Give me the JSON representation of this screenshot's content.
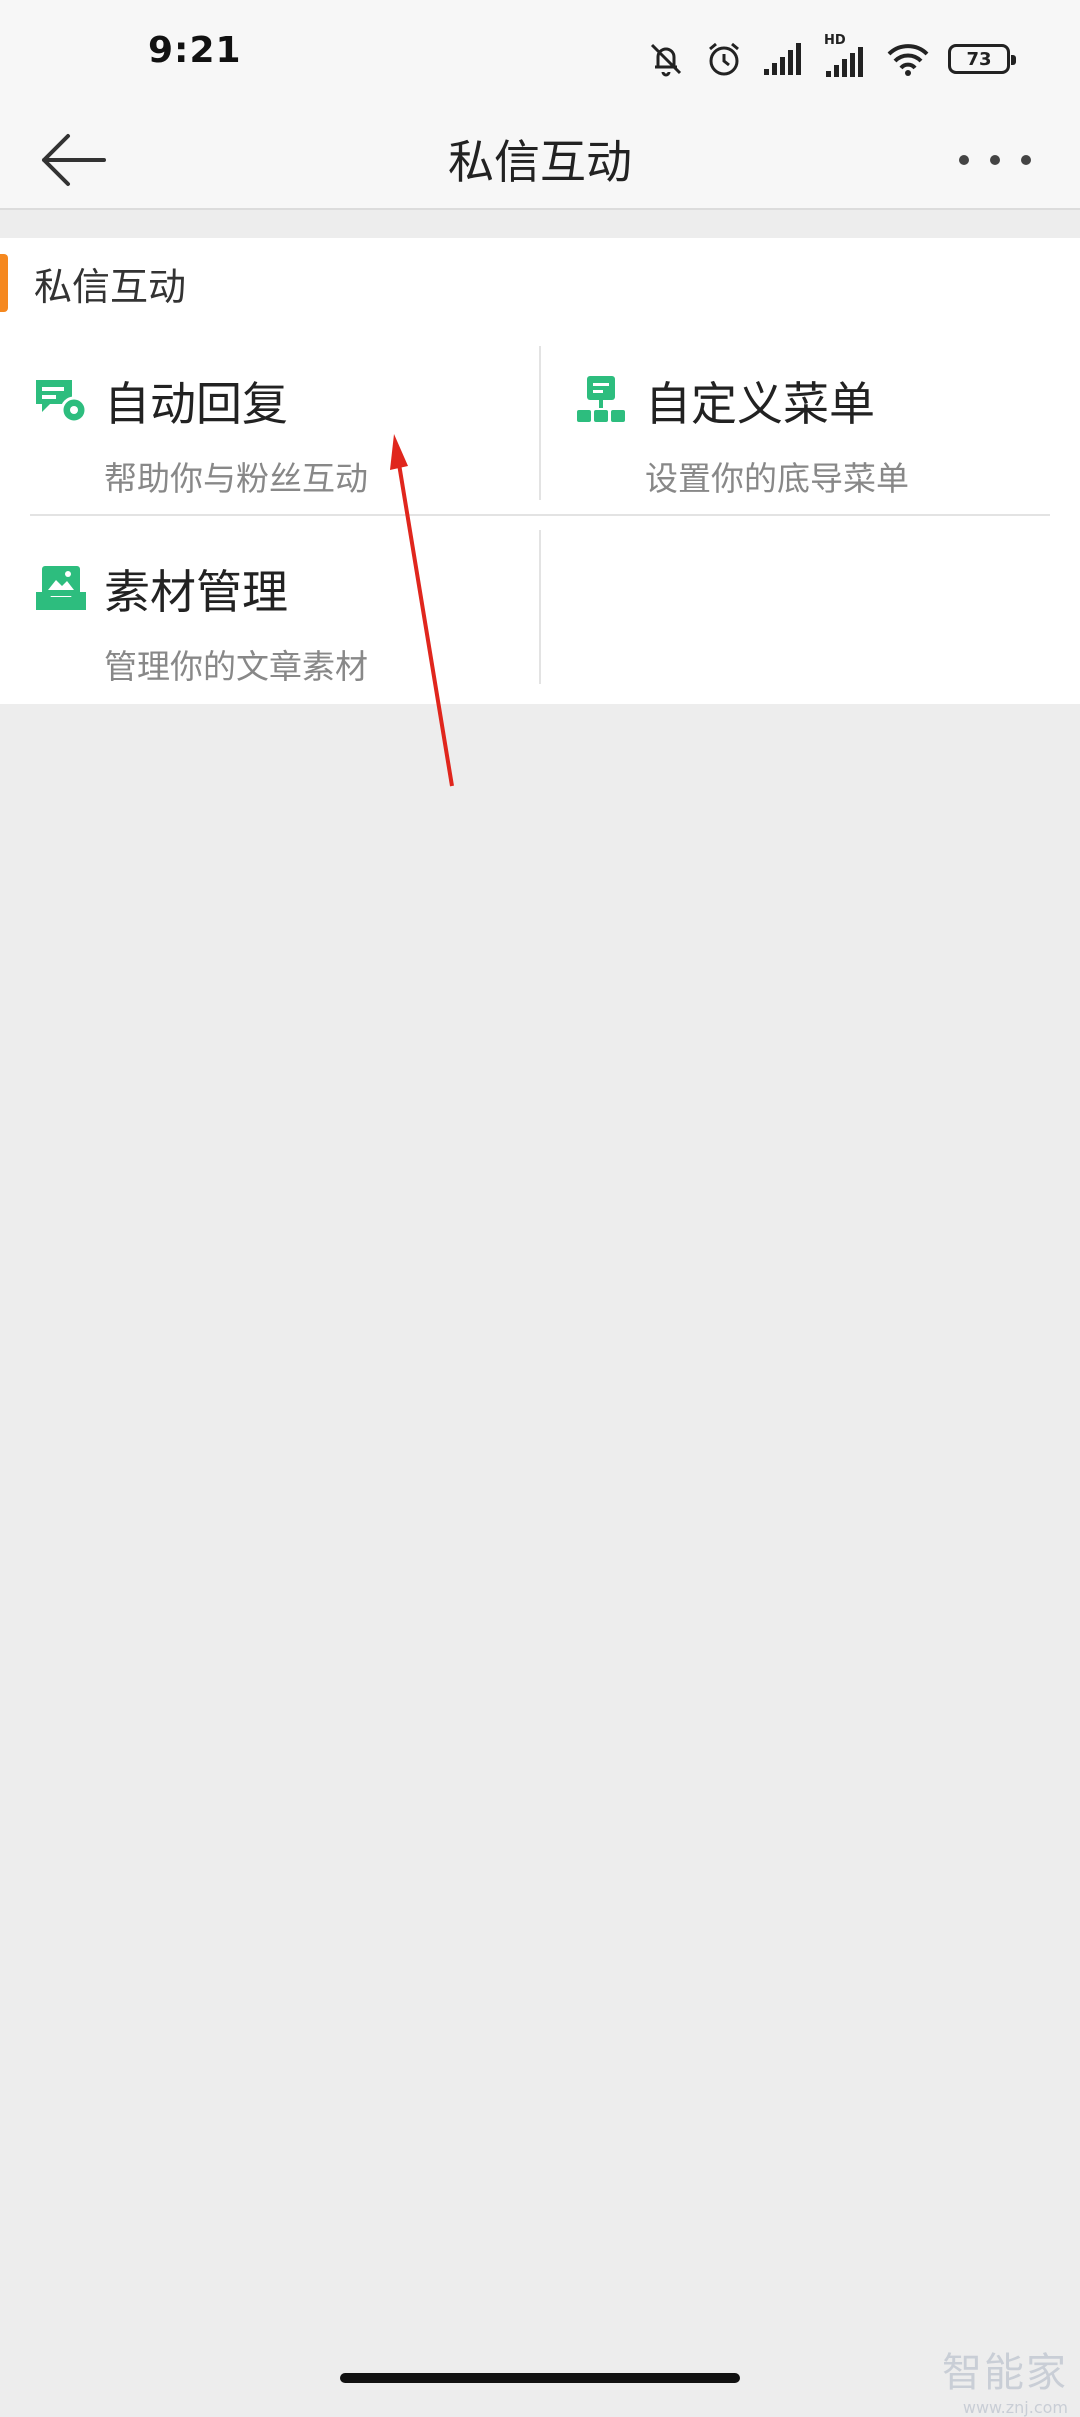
{
  "status_bar": {
    "time": "9:21",
    "battery": "73",
    "network_label": "HD"
  },
  "header": {
    "title": "私信互动"
  },
  "section": {
    "title": "私信互动"
  },
  "features": [
    {
      "name": "自动回复",
      "desc": "帮助你与粉丝互动",
      "icon": "chat-gear-icon"
    },
    {
      "name": "自定义菜单",
      "desc": "设置你的底导菜单",
      "icon": "menu-tree-icon"
    },
    {
      "name": "素材管理",
      "desc": "管理你的文章素材",
      "icon": "image-folder-icon"
    }
  ],
  "colors": {
    "accent": "#f5881f",
    "icon_green": "#2dbd7e",
    "annotation": "#e0261d",
    "background": "#ededed"
  },
  "watermark": {
    "text": "智能家",
    "url": "www.znj.com"
  }
}
